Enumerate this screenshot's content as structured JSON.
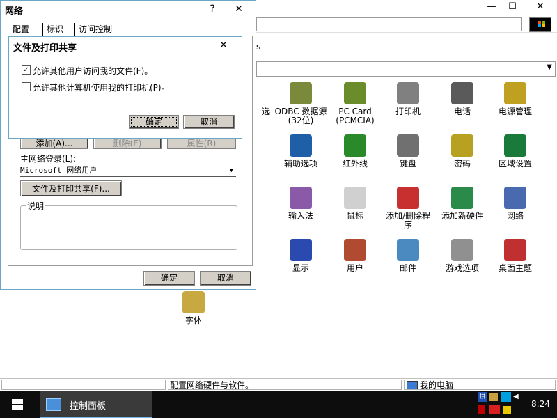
{
  "control_panel": {
    "icons": [
      {
        "label": "选",
        "icon": "partial-icon"
      },
      {
        "label": "ODBC 数据源\n(32位)",
        "icon": "odbc-icon"
      },
      {
        "label": "PC Card\n(PCMCIA)",
        "icon": "pc-card-icon"
      },
      {
        "label": "打印机",
        "icon": "printer-icon"
      },
      {
        "label": "电话",
        "icon": "telephony-icon"
      },
      {
        "label": "电源管理",
        "icon": "power-management-icon"
      },
      {
        "label": "辅助选项",
        "icon": "accessibility-icon"
      },
      {
        "label": "红外线",
        "icon": "infrared-icon"
      },
      {
        "label": "键盘",
        "icon": "keyboard-icon"
      },
      {
        "label": "密码",
        "icon": "passwords-icon"
      },
      {
        "label": "区域设置",
        "icon": "regional-settings-icon"
      },
      {
        "label": "输入法",
        "icon": "input-method-icon"
      },
      {
        "label": "鼠标",
        "icon": "mouse-icon"
      },
      {
        "label": "添加/删除程\n序",
        "icon": "add-remove-programs-icon"
      },
      {
        "label": "添加新硬件",
        "icon": "add-hardware-icon"
      },
      {
        "label": "网络",
        "icon": "network-icon"
      },
      {
        "label": "显示",
        "icon": "display-icon"
      },
      {
        "label": "用户",
        "icon": "users-icon"
      },
      {
        "label": "邮件",
        "icon": "mail-icon"
      },
      {
        "label": "游戏选项",
        "icon": "game-controllers-icon"
      },
      {
        "label": "桌面主题",
        "icon": "desktop-themes-icon"
      },
      {
        "label": "字体",
        "icon": "fonts-icon"
      }
    ],
    "side_fragment": "s",
    "status_text": "配置网络硬件与软件。",
    "status_computer": "我的电脑"
  },
  "network_dialog": {
    "title": "网络",
    "help": "?",
    "close": "✕",
    "tabs": [
      "配置",
      "标识",
      "访问控制"
    ],
    "buttons": {
      "add": "添加(A)...",
      "remove": "删除(E)",
      "properties": "属性(R)",
      "file_print_sharing": "文件及打印共享(F)...",
      "ok": "确定",
      "cancel": "取消"
    },
    "logon_label": "主网络登录(L):",
    "logon_value": "Microsoft 网络用户",
    "description_label": "说明"
  },
  "share_dialog": {
    "title": "文件及打印共享",
    "close": "✕",
    "options": [
      {
        "label": "允许其他用户访问我的文件(F)。",
        "checked": true
      },
      {
        "label": "允许其他计算机使用我的打印机(P)。",
        "checked": false
      }
    ],
    "ok": "确定",
    "cancel": "取消"
  },
  "taskbar": {
    "task_label": "控制面板",
    "clock": "8:24",
    "tray_ime": "拼"
  },
  "window_controls": {
    "minimize": "—",
    "maximize": "☐",
    "close": "✕"
  },
  "colors": {
    "dialog_border": "#6aa7c6",
    "button_face": "#d4d0c8",
    "taskbar": "#0d0d0d"
  }
}
